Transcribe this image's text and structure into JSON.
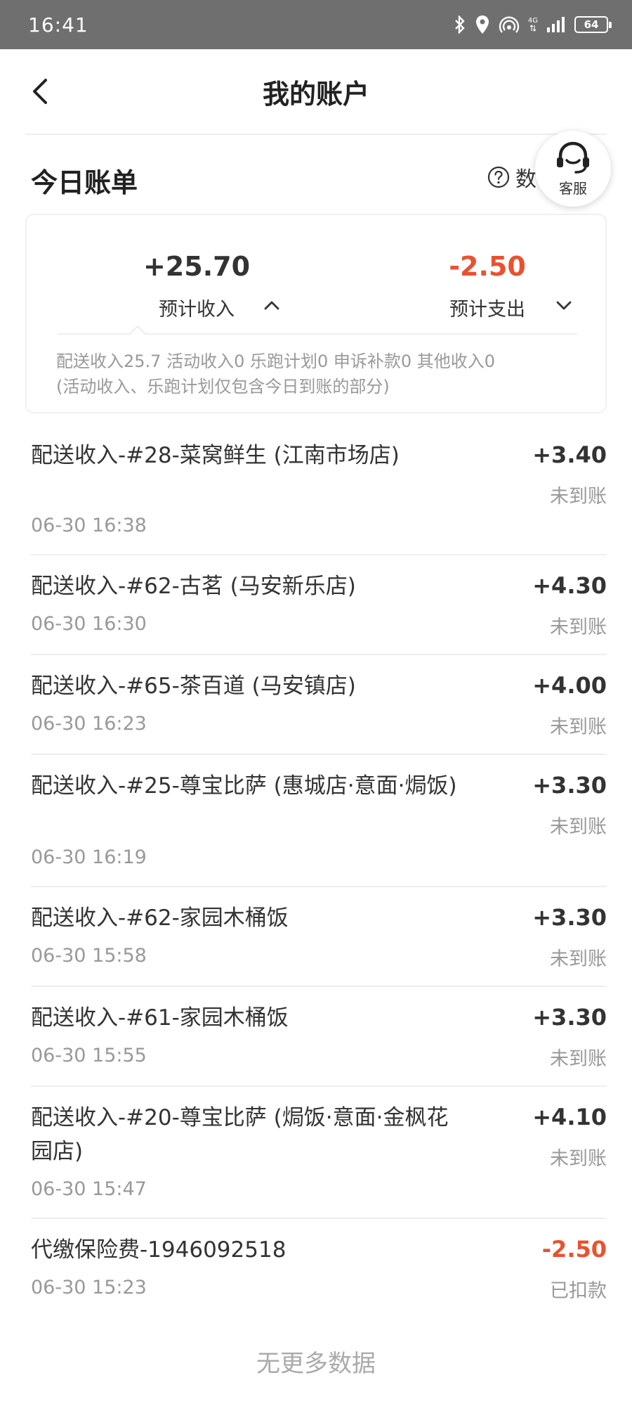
{
  "status_bar": {
    "time": "16:41",
    "network": "4G",
    "battery": "64"
  },
  "header": {
    "title": "我的账户"
  },
  "section": {
    "title": "今日账单",
    "help_label": "数",
    "cs_label": "客服"
  },
  "summary": {
    "income_amount": "+25.70",
    "income_label": "预计收入",
    "expense_amount": "-2.50",
    "expense_label": "预计支出",
    "breakdown_line1": "配送收入25.7 活动收入0 乐跑计划0 申诉补款0 其他收入0",
    "breakdown_line2": "(活动收入、乐跑计划仅包含今日到账的部分)"
  },
  "transactions": [
    {
      "title": "配送收入-#28-菜窝鲜生 (江南市场店)",
      "time": "06-30 16:38",
      "amount": "+3.40",
      "status": "未到账"
    },
    {
      "title": "配送收入-#62-古茗 (马安新乐店)",
      "time": "06-30 16:30",
      "amount": "+4.30",
      "status": "未到账"
    },
    {
      "title": "配送收入-#65-茶百道 (马安镇店)",
      "time": "06-30 16:23",
      "amount": "+4.00",
      "status": "未到账"
    },
    {
      "title": "配送收入-#25-尊宝比萨 (惠城店·意面·焗饭)",
      "time": "06-30 16:19",
      "amount": "+3.30",
      "status": "未到账"
    },
    {
      "title": "配送收入-#62-家园木桶饭",
      "time": "06-30 15:58",
      "amount": "+3.30",
      "status": "未到账"
    },
    {
      "title": "配送收入-#61-家园木桶饭",
      "time": "06-30 15:55",
      "amount": "+3.30",
      "status": "未到账"
    },
    {
      "title": "配送收入-#20-尊宝比萨 (焗饭·意面·金枫花园店)",
      "time": "06-30 15:47",
      "amount": "+4.10",
      "status": "未到账"
    },
    {
      "title": "代缴保险费-1946092518",
      "time": "06-30 15:23",
      "amount": "-2.50",
      "status": "已扣款"
    }
  ],
  "footer": {
    "no_more": "无更多数据"
  },
  "colors": {
    "negative": "#e8522e",
    "status_bar": "#6f6f6f"
  }
}
